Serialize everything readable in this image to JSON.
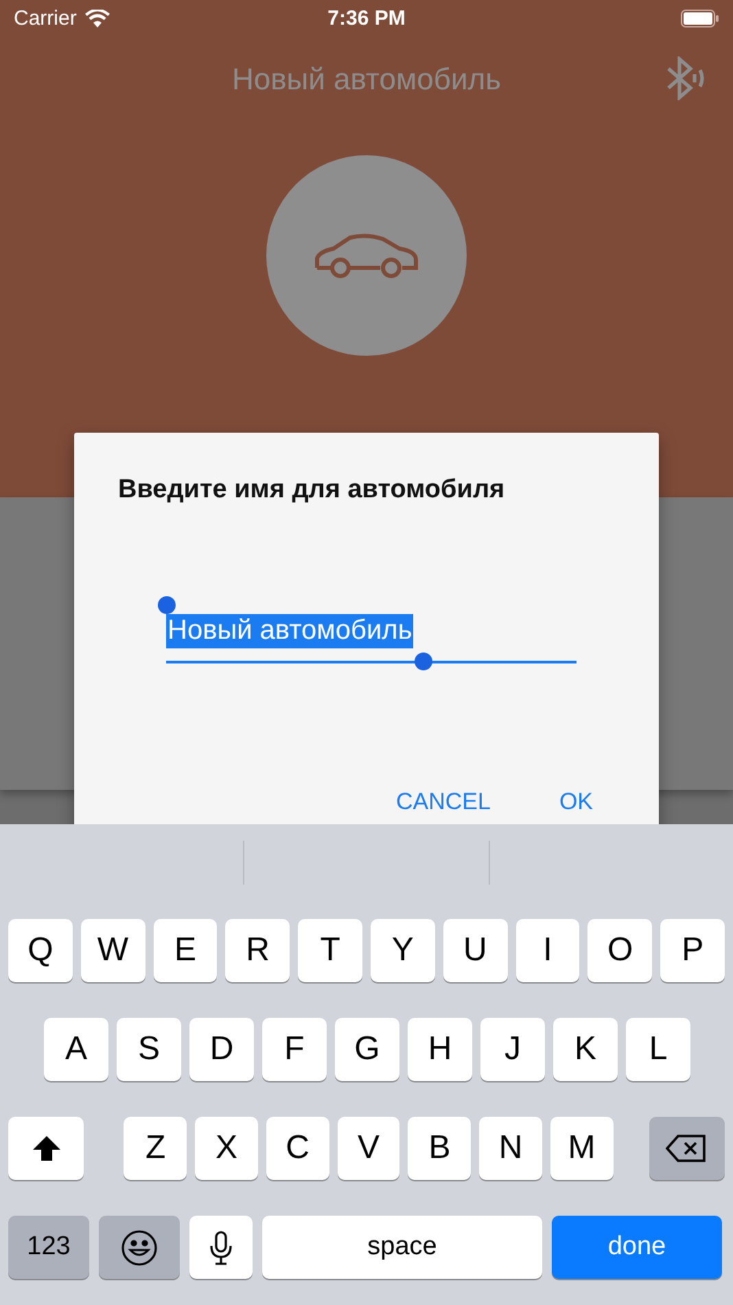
{
  "status_bar": {
    "carrier": "Carrier",
    "time": "7:36 PM"
  },
  "header": {
    "title": "Новый автомобиль"
  },
  "dialog": {
    "title": "Введите имя для автомобиля",
    "field": {
      "value": "Новый автомобиль",
      "selected": true
    },
    "buttons": [
      "CANCEL",
      "OK"
    ]
  },
  "keyboard": {
    "rows": [
      {
        "keys": [
          {
            "kind": "letter",
            "label": "Q"
          },
          {
            "kind": "letter",
            "label": "W"
          },
          {
            "kind": "letter",
            "label": "E"
          },
          {
            "kind": "letter",
            "label": "R"
          },
          {
            "kind": "letter",
            "label": "T"
          },
          {
            "kind": "letter",
            "label": "Y"
          },
          {
            "kind": "letter",
            "label": "U"
          },
          {
            "kind": "letter",
            "label": "I"
          },
          {
            "kind": "letter",
            "label": "O"
          },
          {
            "kind": "letter",
            "label": "P"
          }
        ]
      },
      {
        "keys": [
          {
            "kind": "letter",
            "label": "A"
          },
          {
            "kind": "letter",
            "label": "S"
          },
          {
            "kind": "letter",
            "label": "D"
          },
          {
            "kind": "letter",
            "label": "F"
          },
          {
            "kind": "letter",
            "label": "G"
          },
          {
            "kind": "letter",
            "label": "H"
          },
          {
            "kind": "letter",
            "label": "J"
          },
          {
            "kind": "letter",
            "label": "K"
          },
          {
            "kind": "letter",
            "label": "L"
          }
        ]
      },
      {
        "keys": [
          {
            "kind": "shift"
          },
          {
            "kind": "letter",
            "label": "Z"
          },
          {
            "kind": "letter",
            "label": "X"
          },
          {
            "kind": "letter",
            "label": "C"
          },
          {
            "kind": "letter",
            "label": "V"
          },
          {
            "kind": "letter",
            "label": "B"
          },
          {
            "kind": "letter",
            "label": "N"
          },
          {
            "kind": "letter",
            "label": "M"
          },
          {
            "kind": "backspace"
          }
        ]
      },
      {
        "keys": [
          {
            "kind": "numbers",
            "label": "123"
          },
          {
            "kind": "emoji"
          },
          {
            "kind": "mic"
          },
          {
            "kind": "space",
            "label": "space"
          },
          {
            "kind": "done",
            "label": "done"
          }
        ]
      }
    ]
  }
}
